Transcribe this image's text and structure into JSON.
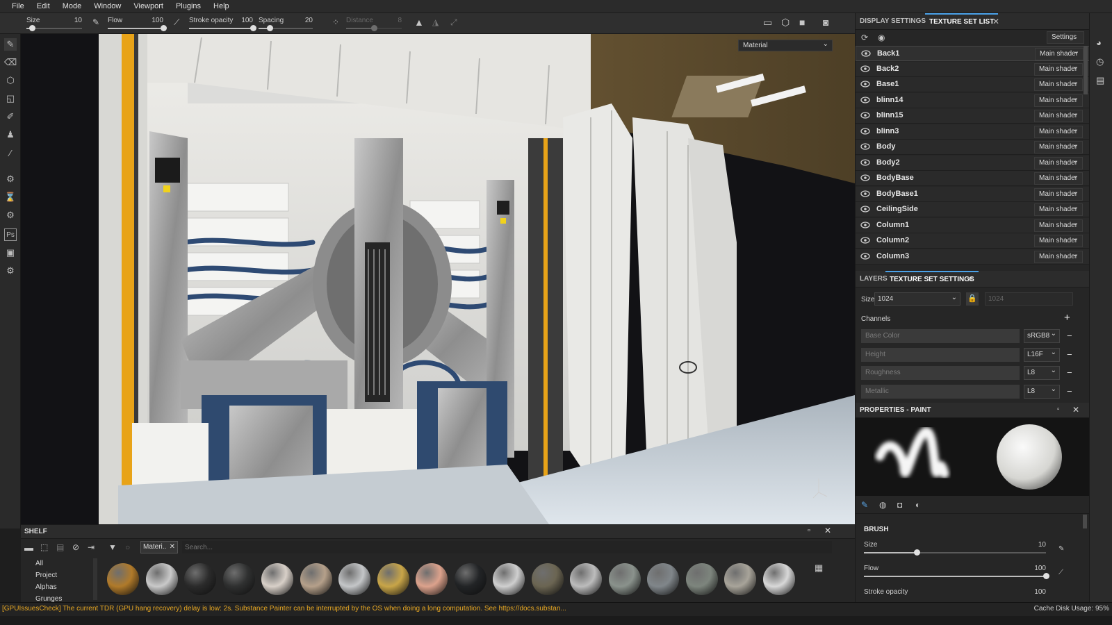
{
  "menu": [
    "File",
    "Edit",
    "Mode",
    "Window",
    "Viewport",
    "Plugins",
    "Help"
  ],
  "toolbar": {
    "size": {
      "label": "Size",
      "value": "10",
      "fraction": 0.1
    },
    "flow": {
      "label": "Flow",
      "value": "100",
      "fraction": 1.0
    },
    "stroke_opacity": {
      "label": "Stroke opacity",
      "value": "100",
      "fraction": 1.0
    },
    "spacing": {
      "label": "Spacing",
      "value": "20",
      "fraction": 0.2
    },
    "distance": {
      "label": "Distance",
      "value": "8",
      "fraction": 0.5
    }
  },
  "viewport": {
    "mode_select": "Material"
  },
  "texture_set_panel": {
    "tabs": [
      "DISPLAY SETTINGS",
      "TEXTURE SET LIST"
    ],
    "active_tab": "TEXTURE SET LIST",
    "settings_label": "Settings",
    "items": [
      {
        "name": "Back1",
        "shader": "Main shader"
      },
      {
        "name": "Back2",
        "shader": "Main shader"
      },
      {
        "name": "Base1",
        "shader": "Main shader"
      },
      {
        "name": "blinn14",
        "shader": "Main shader"
      },
      {
        "name": "blinn15",
        "shader": "Main shader"
      },
      {
        "name": "blinn3",
        "shader": "Main shader"
      },
      {
        "name": "Body",
        "shader": "Main shader"
      },
      {
        "name": "Body2",
        "shader": "Main shader"
      },
      {
        "name": "BodyBase",
        "shader": "Main shader"
      },
      {
        "name": "BodyBase1",
        "shader": "Main shader"
      },
      {
        "name": "CeilingSide",
        "shader": "Main shader"
      },
      {
        "name": "Column1",
        "shader": "Main shader"
      },
      {
        "name": "Column2",
        "shader": "Main shader"
      },
      {
        "name": "Column3",
        "shader": "Main shader"
      }
    ]
  },
  "texture_set_settings": {
    "tabs": [
      "LAYERS",
      "TEXTURE SET SETTINGS"
    ],
    "active_tab": "TEXTURE SET SETTINGS",
    "size_label": "Size",
    "size_value": "1024",
    "size_value_locked": "1024",
    "channels_label": "Channels",
    "channels": [
      {
        "name": "Base Color",
        "format": "sRGB8"
      },
      {
        "name": "Height",
        "format": "L16F"
      },
      {
        "name": "Roughness",
        "format": "L8"
      },
      {
        "name": "Metallic",
        "format": "L8"
      }
    ]
  },
  "properties": {
    "title": "PROPERTIES - PAINT",
    "brush_section": "BRUSH",
    "size": {
      "label": "Size",
      "value": "10",
      "fraction": 0.29
    },
    "flow": {
      "label": "Flow",
      "value": "100",
      "fraction": 1.0
    },
    "stroke_opacity": {
      "label": "Stroke opacity",
      "value": "100"
    }
  },
  "shelf": {
    "title": "SHELF",
    "filter_tag": "Materi..",
    "search_placeholder": "Search...",
    "categories": [
      "All",
      "Project",
      "Alphas",
      "Grunges"
    ],
    "ball_colors": [
      "#b07a2a",
      "#c9c9c9",
      "#2b2b2b",
      "#2f3030",
      "#d8d0c8",
      "#b5a08a",
      "#c4c6c8",
      "#c8a548",
      "#dca28c",
      "#222426",
      "#cfcfcf",
      "#6b6552",
      "#bcbcbc",
      "#8a928c",
      "#80868a",
      "#7d857d",
      "#a8a49a",
      "#d8d8d8"
    ]
  },
  "status": {
    "message": "[GPUIssuesCheck] The current TDR (GPU hang recovery) delay is low: 2s. Substance Painter can be interrupted by the OS when doing a long computation. See https://docs.substan...",
    "cache": "Cache Disk Usage:   95%"
  }
}
